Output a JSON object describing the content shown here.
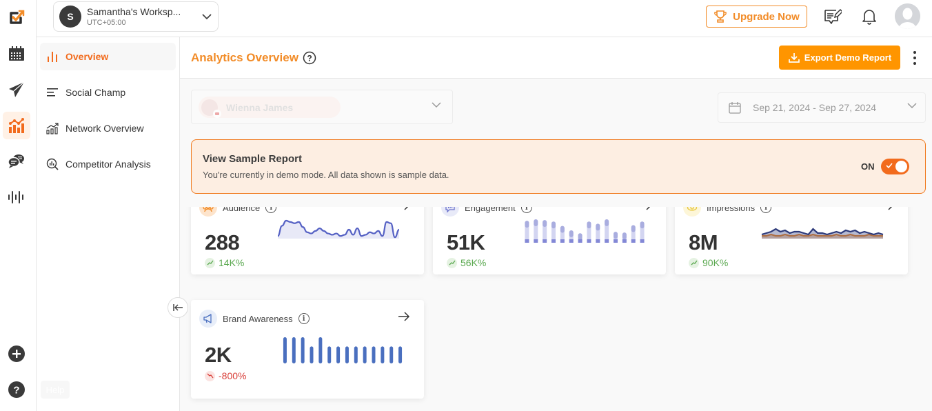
{
  "workspace": {
    "initial": "S",
    "name": "Samantha's Worksp...",
    "timezone": "UTC+05:00"
  },
  "topbar": {
    "upgrade_label": "Upgrade Now"
  },
  "rail": {
    "items": [
      {
        "name": "calendar",
        "active": false
      },
      {
        "name": "publish",
        "active": false
      },
      {
        "name": "analytics",
        "active": true
      },
      {
        "name": "engage",
        "active": false
      },
      {
        "name": "listening",
        "active": false
      }
    ],
    "help_tooltip": "Help"
  },
  "subnav": {
    "items": [
      {
        "label": "Overview",
        "active": true
      },
      {
        "label": "Social Champ",
        "active": false
      },
      {
        "label": "Network Overview",
        "active": false
      },
      {
        "label": "Competitor Analysis",
        "active": false
      }
    ]
  },
  "page": {
    "title": "Analytics Overview",
    "export_label": "Export Demo Report",
    "profile_name": "Wienna James",
    "date_range": "Sep 21, 2024 - Sep 27, 2024"
  },
  "banner": {
    "title": "View Sample Report",
    "subtitle": "You're currently in demo mode. All data shown is sample data.",
    "toggle_label": "ON",
    "toggle_on": true
  },
  "colors": {
    "accent": "#f28c28",
    "primary_orange": "#ff9500",
    "toggle": "#f26b1d",
    "positive": "#5aa84f",
    "negative": "#d9403a"
  },
  "cards": [
    {
      "title": "Audience",
      "value": "288",
      "change": "14K%",
      "trend": "up",
      "spark": {
        "type": "area-line",
        "color": "#5561c4",
        "values": [
          2,
          10,
          14,
          13,
          12,
          13,
          9,
          5,
          4,
          6,
          8,
          6,
          4,
          3,
          4,
          2,
          3,
          7,
          3,
          8,
          2,
          3,
          5,
          4,
          6,
          2,
          13,
          12,
          1,
          7
        ]
      }
    },
    {
      "title": "Engagement",
      "value": "51K",
      "change": "56K%",
      "trend": "up",
      "spark": {
        "type": "bar",
        "color": "#8388d6",
        "values": [
          30,
          32,
          31,
          29,
          23,
          17,
          13,
          29,
          26,
          32,
          15,
          14,
          24,
          29
        ]
      }
    },
    {
      "title": "Impressions",
      "value": "8M",
      "change": "90K%",
      "trend": "up",
      "spark": {
        "type": "multi-line",
        "series": [
          {
            "name": "series-a",
            "color": "#2d3a7a",
            "values": [
              3,
              4,
              5,
              7,
              5,
              6,
              4,
              5,
              5,
              4,
              3,
              7,
              4,
              4,
              3,
              4,
              5,
              4,
              6,
              5,
              6,
              4,
              5,
              4,
              3,
              4,
              3
            ]
          },
          {
            "name": "series-b",
            "color": "#f28c28",
            "values": [
              2,
              2,
              3,
              2,
              2,
              3,
              2,
              2,
              3,
              2,
              2,
              3,
              2,
              2,
              2,
              2,
              3,
              2,
              2,
              3,
              2,
              2,
              2,
              3,
              2,
              2,
              2
            ]
          }
        ]
      }
    },
    {
      "title": "Brand Awareness",
      "value": "2K",
      "change": "-800%",
      "trend": "down",
      "spark": {
        "type": "bar",
        "color": "#4a6fbf",
        "values": [
          34,
          34,
          34,
          22,
          34,
          22,
          22,
          22,
          22,
          22,
          22,
          22,
          22,
          22
        ]
      }
    }
  ]
}
